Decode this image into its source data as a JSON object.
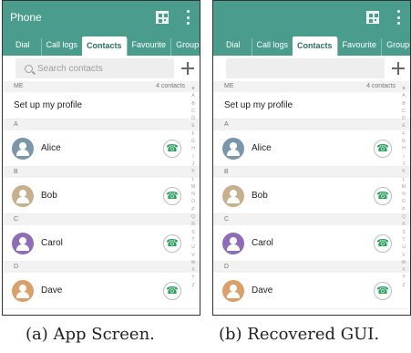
{
  "colors": {
    "accent": "#4a9c8c",
    "call_green": "#2e9e5e",
    "section_bg": "#f2f2f2"
  },
  "screens": [
    {
      "appbar": {
        "title": "Phone",
        "qr_icon": "qr-code-icon",
        "menu_icon": "more-vert-icon"
      },
      "tabs": [
        "Dial",
        "Call logs",
        "Contacts",
        "Favourite",
        "Groups"
      ],
      "active_tab": "Contacts",
      "search": {
        "placeholder": "Search contacts",
        "add_icon": "plus-icon"
      },
      "me_section": {
        "label": "ME",
        "count": "4 contacts",
        "profile_text": "Set up my profile"
      },
      "contacts": [
        {
          "section": "A",
          "name": "Alice",
          "avatar_color": "#7a96a8"
        },
        {
          "section": "B",
          "name": "Bob",
          "avatar_color": "#c6b08e"
        },
        {
          "section": "C",
          "name": "Carol",
          "avatar_color": "#8e6cb8"
        },
        {
          "section": "D",
          "name": "Dave",
          "avatar_color": "#d9a06a"
        }
      ],
      "index_letters": [
        "★",
        "A",
        "B",
        "C",
        "D",
        "E",
        "F",
        "G",
        "H",
        "I",
        "J",
        "K",
        "L",
        "M",
        "N",
        "O",
        "P",
        "Q",
        "R",
        "S",
        "T",
        "U",
        "V",
        "W",
        "X",
        "Y",
        "Z"
      ],
      "caption": "(a) App Screen."
    },
    {
      "appbar": {
        "title": "",
        "qr_icon": "qr-code-icon",
        "menu_icon": "more-vert-icon"
      },
      "tabs": [
        "Dial",
        "Call logs",
        "Contacts",
        "Favourite",
        "Groups"
      ],
      "active_tab": "Contacts",
      "search": {
        "placeholder": "",
        "add_icon": "plus-icon"
      },
      "me_section": {
        "label": "ME",
        "count": "4 contacts",
        "profile_text": "Set up my profile"
      },
      "contacts": [
        {
          "section": "A",
          "name": "Alice",
          "avatar_color": "#7a96a8"
        },
        {
          "section": "B",
          "name": "Bob",
          "avatar_color": "#c6b08e"
        },
        {
          "section": "C",
          "name": "Carol",
          "avatar_color": "#8e6cb8"
        },
        {
          "section": "D",
          "name": "Dave",
          "avatar_color": "#d9a06a"
        }
      ],
      "index_letters": [
        "★",
        "A",
        "B",
        "C",
        "D",
        "E",
        "F",
        "G",
        "H",
        "I",
        "J",
        "K",
        "L",
        "M",
        "N",
        "O",
        "P",
        "Q",
        "R",
        "S",
        "T",
        "U",
        "V",
        "W",
        "X",
        "Y",
        "Z"
      ],
      "caption": "(b) Recovered GUI."
    }
  ]
}
